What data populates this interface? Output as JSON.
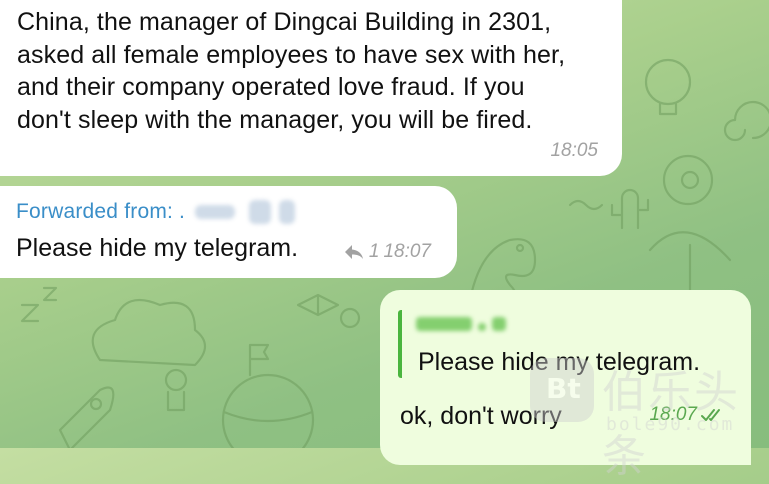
{
  "messages": [
    {
      "direction": "incoming",
      "lines": [
        "China, the manager of Dingcai Building in 2301,",
        "asked all female employees to have sex with her,",
        "and their company operated love fraud. If you",
        "don't sleep with the manager, you will be fired."
      ],
      "time": "18:05"
    },
    {
      "direction": "incoming",
      "forwarded_label": "Forwarded from:",
      "forwarded_name_dot": ".",
      "text": "Please hide my telegram.",
      "share_icon": "share-arrow-icon",
      "share_count": "1",
      "time": "18:07"
    },
    {
      "direction": "outgoing",
      "reply_name_suffix": "...",
      "reply_text": "Please hide my telegram.",
      "text": "ok, don't worry",
      "time": "18:07",
      "status_icon": "double-check-icon"
    }
  ],
  "watermark": {
    "logo_text": "Bt",
    "title": "伯乐头条",
    "url": "bole90.com"
  },
  "colors": {
    "incoming_bubble": "#ffffff",
    "outgoing_bubble": "#effdde",
    "forward_label": "#3a8ec8",
    "outgoing_time": "#5aa84f",
    "reply_bar": "#4ab53e"
  }
}
